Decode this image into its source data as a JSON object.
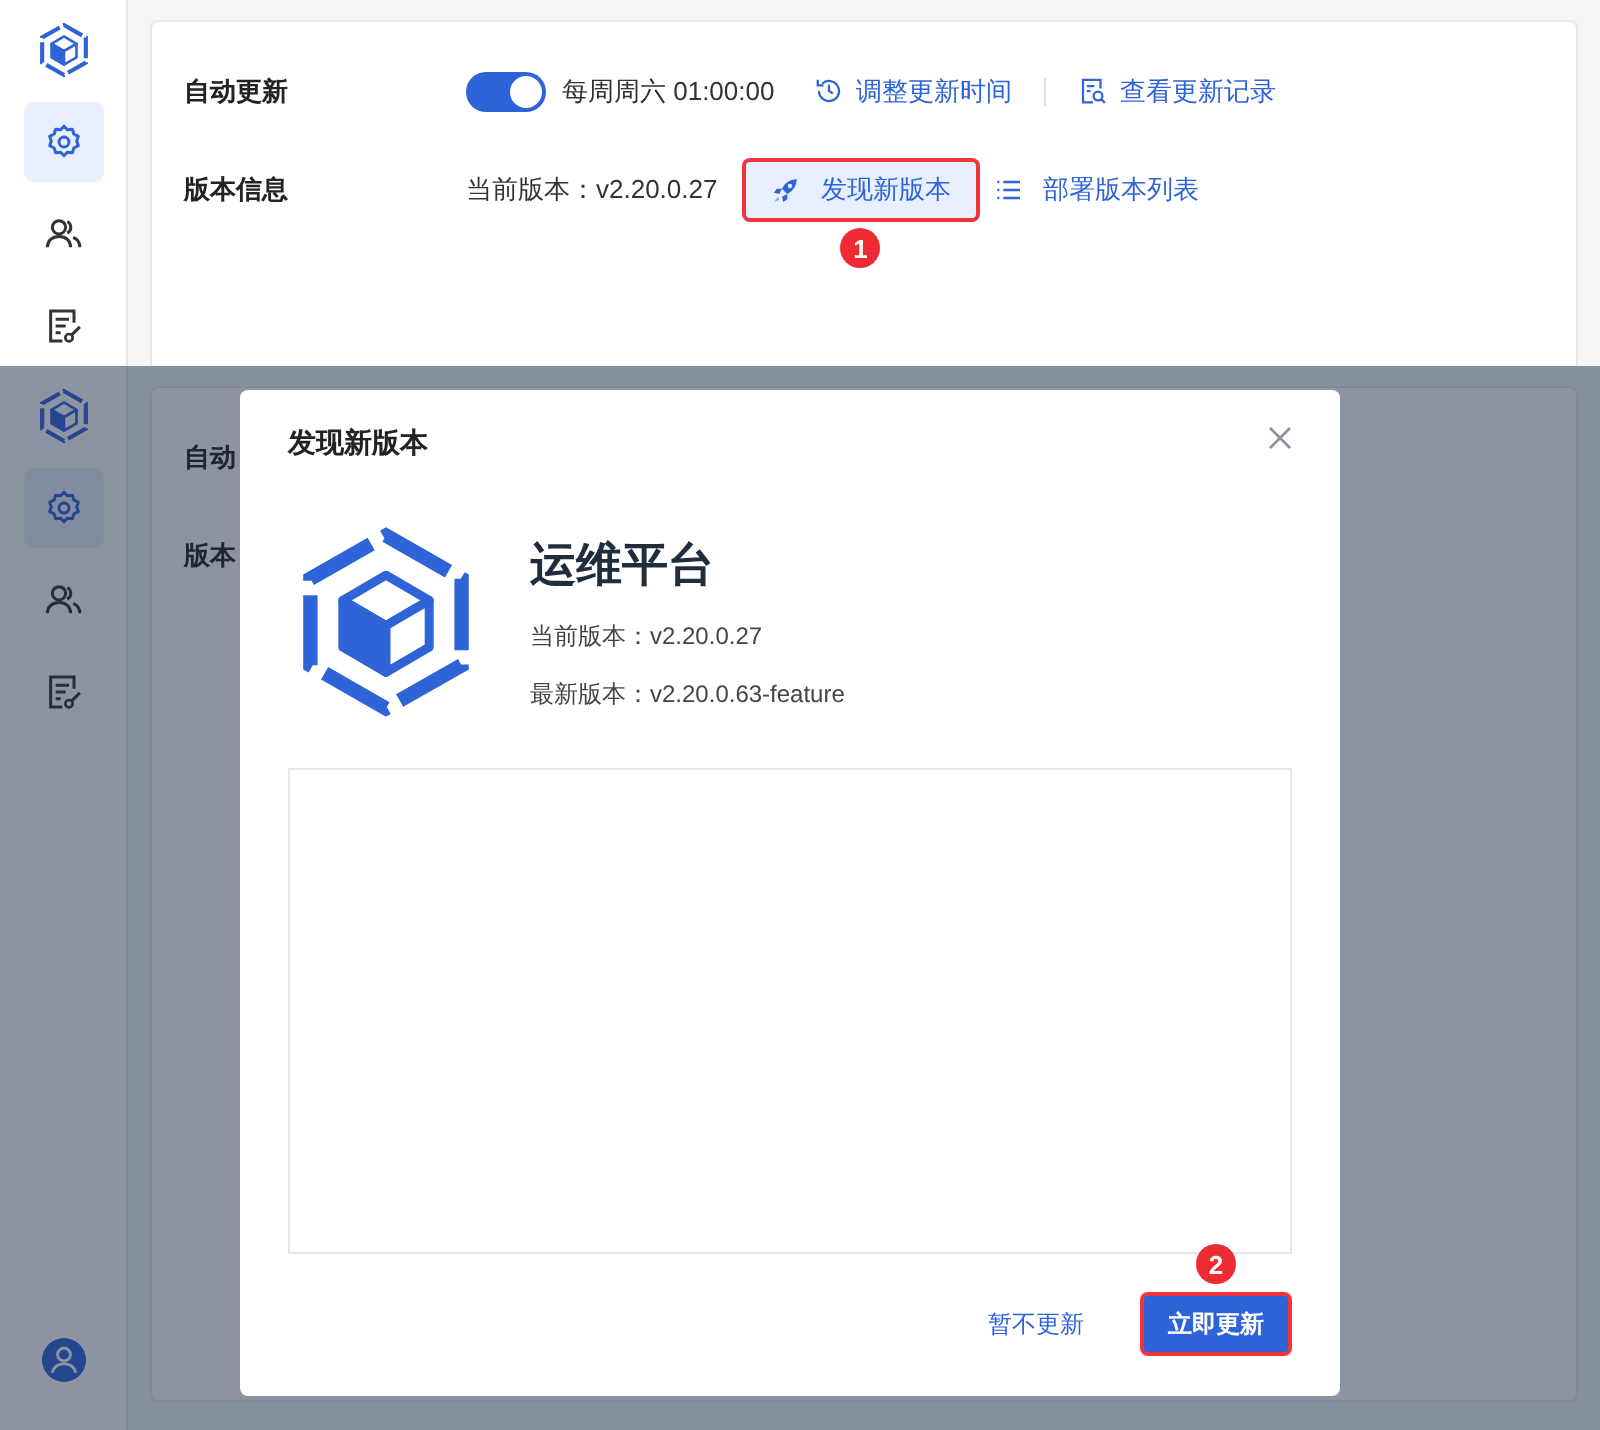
{
  "top_screen": {
    "sidebar": {
      "nav_items": [
        {
          "selected": true
        },
        {
          "selected": false
        },
        {
          "selected": false
        }
      ]
    },
    "auto_update": {
      "label": "自动更新",
      "on": true,
      "schedule": "每周周六 01:00:00",
      "actions": [
        "调整更新时间",
        "查看更新记录"
      ]
    },
    "version_info": {
      "label": "版本信息",
      "current": "当前版本：v2.20.0.27",
      "actions": [
        {
          "label": "发现新版本",
          "kind": "tinted",
          "callout": "1"
        },
        {
          "label": "部署版本列表",
          "kind": "plain"
        }
      ]
    }
  },
  "bottom_screen": {
    "sidebar": {
      "nav_items": [
        {
          "selected": true
        },
        {
          "selected": false
        },
        {
          "selected": false
        }
      ]
    },
    "background_labels": [
      "自动",
      "版本"
    ],
    "dialog": {
      "title": "发现新版本",
      "product_name": "运维平台",
      "current_version": "当前版本：v2.20.0.27",
      "latest_version": "最新版本：v2.20.0.63-feature",
      "buttons": [
        {
          "label": "暂不更新",
          "kind": "link"
        },
        {
          "label": "立即更新",
          "kind": "primary",
          "callout": "2"
        }
      ]
    }
  }
}
